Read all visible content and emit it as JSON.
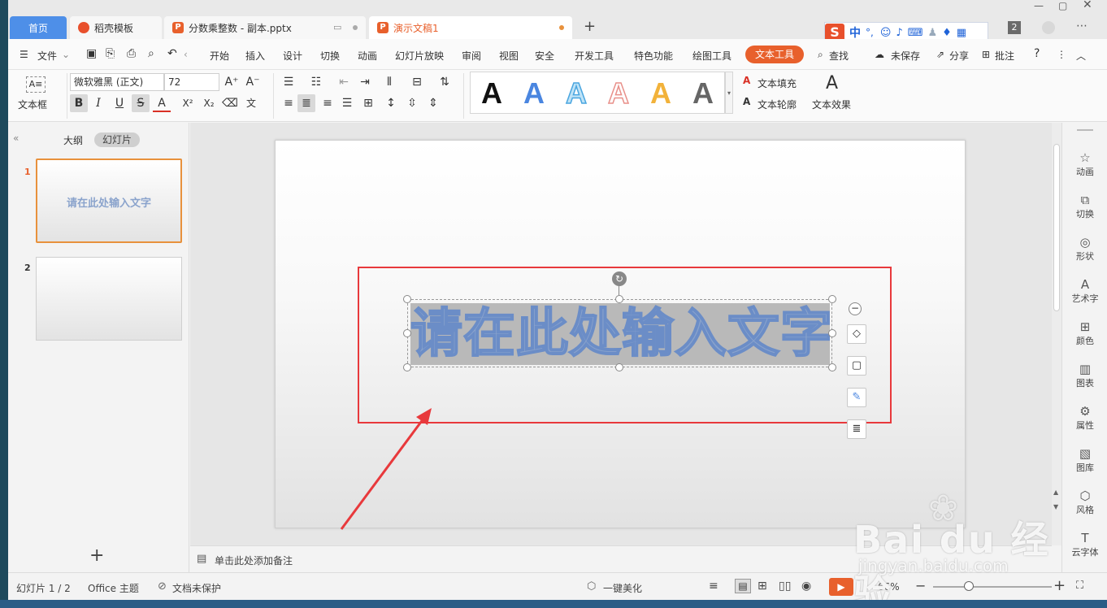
{
  "tabs": [
    {
      "label": "首页"
    },
    {
      "label": "稻壳模板"
    },
    {
      "label": "分数乘整数 - 副本.pptx"
    },
    {
      "label": "演示文稿1"
    }
  ],
  "new_tab": "+",
  "tab_badge": "2",
  "ime": {
    "logo": "S",
    "lang": "中",
    "punct": "°,"
  },
  "menu": {
    "file": "文件",
    "items": [
      "开始",
      "插入",
      "设计",
      "切换",
      "动画",
      "幻灯片放映",
      "审阅",
      "视图",
      "安全",
      "开发工具",
      "特色功能",
      "绘图工具"
    ],
    "active": "文本工具",
    "search": "查找",
    "unsaved": "未保存",
    "share": "分享",
    "comment": "批注",
    "help": "?"
  },
  "ribbon": {
    "textbox_label": "文本框",
    "font_name": "微软雅黑 (正文)",
    "font_size": "72",
    "style_letters": [
      "A",
      "A",
      "A",
      "A",
      "A",
      "A"
    ],
    "text_fill": "文本填充",
    "text_outline": "文本轮廓",
    "text_effect": "文本效果"
  },
  "left_pane": {
    "tab_outline": "大纲",
    "tab_slides": "幻灯片",
    "slides": [
      {
        "num": "1",
        "text": "请在此处输入文字"
      },
      {
        "num": "2",
        "text": ""
      }
    ],
    "add": "+"
  },
  "slide": {
    "text": "请在此处输入文字"
  },
  "notes_placeholder": "单击此处添加备注",
  "right_sidebar": [
    "动画",
    "切换",
    "形状",
    "艺术字",
    "颜色",
    "图表",
    "属性",
    "图库",
    "风格",
    "云字体"
  ],
  "status": {
    "slide_counter": "幻灯片 1 / 2",
    "theme": "Office 主题",
    "protect": "文档未保护",
    "beautify": "一键美化",
    "zoom": "66%"
  },
  "watermark": {
    "brand": "Bai du 经验",
    "url": "jingyan.baidu.com"
  },
  "colors": {
    "accent": "#e8602c",
    "home_tab": "#4e8fe8",
    "annotation_red": "#e8393c"
  }
}
